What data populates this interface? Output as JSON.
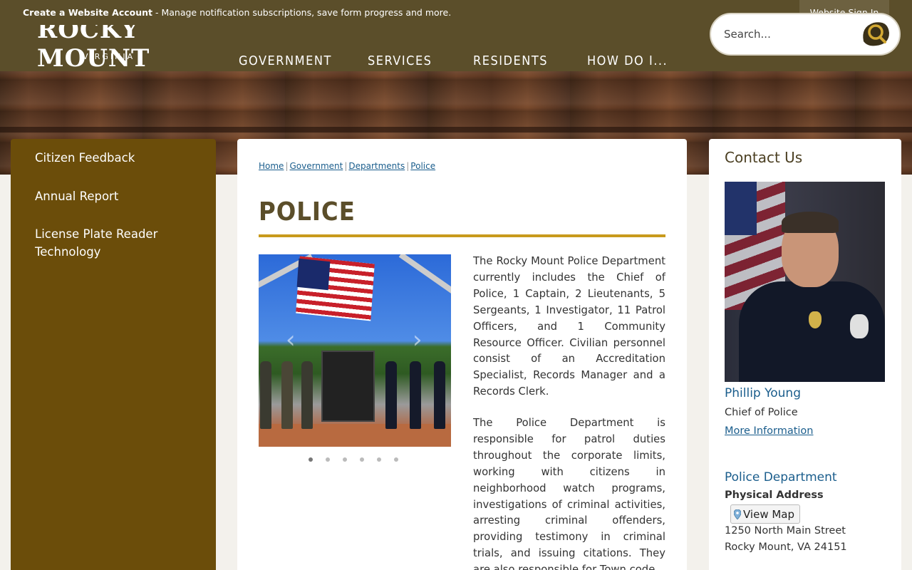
{
  "topbar": {
    "create_account": "Create a Website Account",
    "message": " - Manage notification subscriptions, save form progress and more.",
    "signin": "Website Sign In"
  },
  "header": {
    "logo_text": "ROCKY MOUNT",
    "logo_sub": "VIRGINIA",
    "nav": [
      "GOVERNMENT",
      "SERVICES",
      "RESIDENTS",
      "HOW DO I..."
    ],
    "search_placeholder": "Search..."
  },
  "sidebar": {
    "items": [
      "Citizen Feedback",
      "Annual Report",
      "License Plate Reader Technology"
    ]
  },
  "main": {
    "breadcrumb": [
      "Home",
      "Government",
      "Departments",
      "Police"
    ],
    "title": "POLICE",
    "slideshow": {
      "slides": 6,
      "active": 1
    },
    "paragraphs": [
      "The Rocky Mount Police Department currently includes the Chief of Police, 1 Captain, 2 Lieutenants, 5 Sergeants, 1 Investigator, 11 Patrol Officers, and 1 Community Resource Officer. Civilian personnel consist of an Accreditation Specialist, Records Manager and a Records Clerk.",
      "The Police Department is responsible for patrol duties throughout the corporate limits, working with citizens in neighborhood watch programs, investigations of criminal activities, arresting criminal offenders, providing testimony in criminal trials, and issuing citations. They are also responsible for Town code"
    ]
  },
  "contact": {
    "title": "Contact Us",
    "name": "Phillip Young",
    "role": "Chief of Police",
    "more_info": "More Information",
    "department": "Police Department",
    "address_label": "Physical Address",
    "map_button": "View Map",
    "address_lines": [
      "1250 North Main Street",
      "Rocky Mount, VA 24151"
    ]
  },
  "colors": {
    "header_bg": "#5b4e2a",
    "sidebar_bg": "#6b4d0a",
    "accent_rule": "#c89a1c",
    "link": "#1a5d8c"
  }
}
